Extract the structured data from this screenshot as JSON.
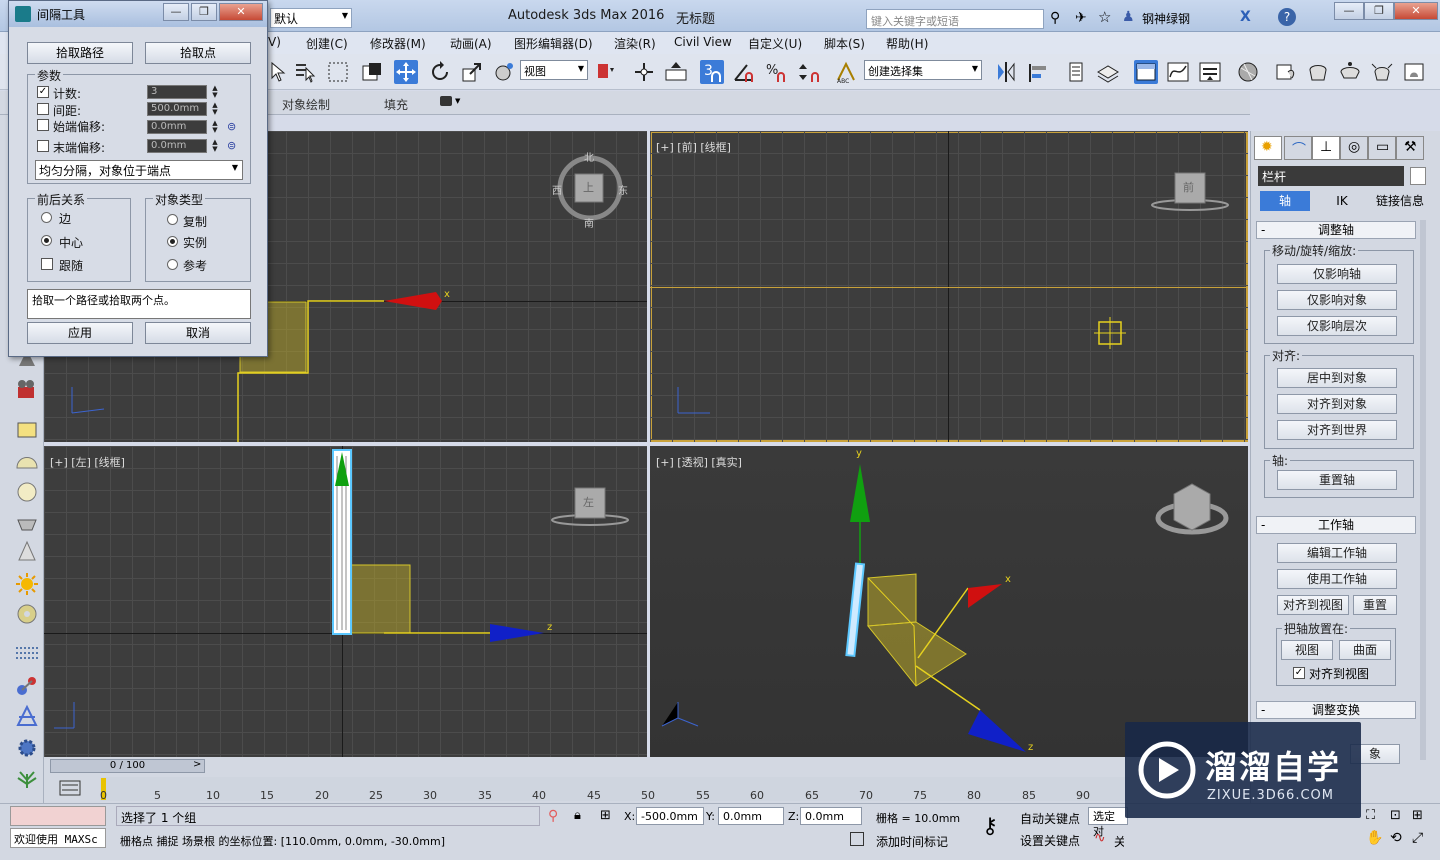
{
  "app": {
    "title": "Autodesk 3ds Max 2016",
    "doc_title": "无标题",
    "workspace": "默认",
    "search_placeholder": "键入关键字或短语",
    "user": "钢神绿钢"
  },
  "menu": [
    "V)",
    "创建(C)",
    "修改器(M)",
    "动画(A)",
    "图形编辑器(D)",
    "渲染(R)",
    "Civil View",
    "自定义(U)",
    "脚本(S)",
    "帮助(H)"
  ],
  "toolbar": {
    "view_select": "视图",
    "selection_set": "创建选择集",
    "snap_number": "3"
  },
  "ribbon_tabs": [
    "对象绘制",
    "填充"
  ],
  "dialog": {
    "title": "间隔工具",
    "pick_path": "拾取路径",
    "pick_points": "拾取点",
    "params_label": "参数",
    "count_label": "计数:",
    "count_value": "3",
    "spacing_label": "间距:",
    "spacing_value": "500.0mm",
    "start_offset_label": "始端偏移:",
    "start_offset_value": "0.0mm",
    "end_offset_label": "末端偏移:",
    "end_offset_value": "0.0mm",
    "distribution": "均匀分隔，对象位于端点",
    "context_label": "前后关系",
    "ctx_edges": "边",
    "ctx_centers": "中心",
    "ctx_follow": "跟随",
    "type_label": "对象类型",
    "type_copy": "复制",
    "type_instance": "实例",
    "type_reference": "参考",
    "status_text": "拾取一个路径或拾取两个点。",
    "apply": "应用",
    "cancel": "取消"
  },
  "viewports": {
    "top": {
      "label": "",
      "cube_n": "北",
      "cube_s": "南",
      "cube_e": "东",
      "cube_w": "西",
      "cube_face": "上",
      "axis_x": "x"
    },
    "front": {
      "label": "[+] [前] [线框]",
      "cube_face": "前"
    },
    "left": {
      "label": "[+] [左] [线框]",
      "cube_face": "左",
      "axis_z": "z"
    },
    "persp": {
      "label": "[+] [透视] [真实]",
      "axis_x": "x",
      "axis_y": "y",
      "axis_z": "z"
    }
  },
  "right_panel": {
    "object_name": "栏杆",
    "tab_pivot": "轴",
    "tab_ik": "IK",
    "tab_link": "链接信息",
    "sec_adjust_pivot": "调整轴",
    "grp_move": "移动/旋转/缩放:",
    "btn_affect_pivot": "仅影响轴",
    "btn_affect_object": "仅影响对象",
    "btn_affect_hierarchy": "仅影响层次",
    "grp_align": "对齐:",
    "btn_center_obj": "居中到对象",
    "btn_align_obj": "对齐到对象",
    "btn_align_world": "对齐到世界",
    "grp_pivot": "轴:",
    "btn_reset_pivot": "重置轴",
    "sec_working_pivot": "工作轴",
    "btn_edit_wp": "编辑工作轴",
    "btn_use_wp": "使用工作轴",
    "btn_align_view": "对齐到视图",
    "btn_reset": "重置",
    "grp_place_pivot": "把轴放置在:",
    "btn_view": "视图",
    "btn_surface": "曲面",
    "chk_align_view": "对齐到视图",
    "sec_adjust_transform": "调整变换",
    "btn_partial": "象"
  },
  "timeline": {
    "slider": "0 / 100",
    "ticks": [
      "0",
      "5",
      "10",
      "15",
      "20",
      "25",
      "30",
      "35",
      "40",
      "45",
      "50",
      "55",
      "60",
      "65",
      "70",
      "75",
      "80",
      "85",
      "90"
    ]
  },
  "status": {
    "welcome": "欢迎使用 MAXSc",
    "selected": "选择了 1 个组",
    "snap_info": "栅格点 捕捉 场景根 的坐标位置: [110.0mm, 0.0mm, -30.0mm]",
    "x_label": "X:",
    "x_value": "-500.0mm",
    "y_label": "Y:",
    "y_value": "0.0mm",
    "z_label": "Z:",
    "z_value": "0.0mm",
    "grid": "栅格 = 10.0mm",
    "add_time_tag": "添加时间标记",
    "auto_key": "自动关键点",
    "set_key": "设置关键点",
    "selected_obj": "选定对",
    "key_filters": "关键点过滤器..."
  },
  "watermark": {
    "brand": "溜溜自学",
    "url": "ZIXUE.3D66.COM"
  },
  "colors": {
    "accent_blue": "#3b7bd8",
    "x_axis": "#d01010",
    "y_axis": "#10a010",
    "z_axis": "#1020c8",
    "selection_yellow": "#e6d21f"
  }
}
